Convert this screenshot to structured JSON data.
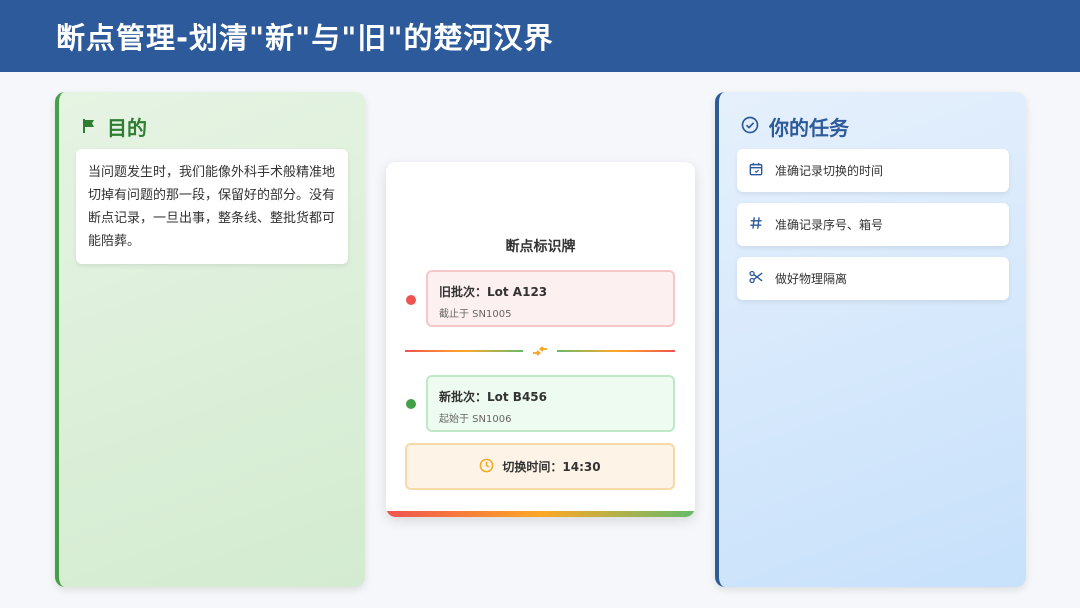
{
  "header": {
    "title": "断点管理-划清\"新\"与\"旧\"的楚河汉界"
  },
  "purpose": {
    "title": "目的",
    "icon": "flag-icon",
    "text": "当问题发生时，我们能像外科手术般精准地切掉有问题的那一段，保留好的部分。没有断点记录，一旦出事，整条线、整批货都可能陪葬。"
  },
  "tasks": {
    "title": "你的任务",
    "icon": "check-circle-icon",
    "items": [
      {
        "label": "准确记录切换的时间",
        "icon": "calendar-icon"
      },
      {
        "label": "准确记录序号、箱号",
        "icon": "hash-icon"
      },
      {
        "label": "做好物理隔离",
        "icon": "scissors-icon"
      }
    ]
  },
  "sign": {
    "title": "断点标识牌",
    "old_lot": {
      "main": "旧批次：Lot A123",
      "sub": "截止于 SN1005",
      "color": "#ef5350"
    },
    "new_lot": {
      "main": "新批次：Lot B456",
      "sub": "起始于 SN1006",
      "color": "#43a047"
    },
    "switch_time": {
      "text": "切换时间：14:30",
      "icon": "clock-icon",
      "color": "#f5a623"
    }
  },
  "colors": {
    "header_bg": "#2d5a9b",
    "purpose_accent": "#2e7d32",
    "tasks_accent": "#2d5a9b"
  }
}
